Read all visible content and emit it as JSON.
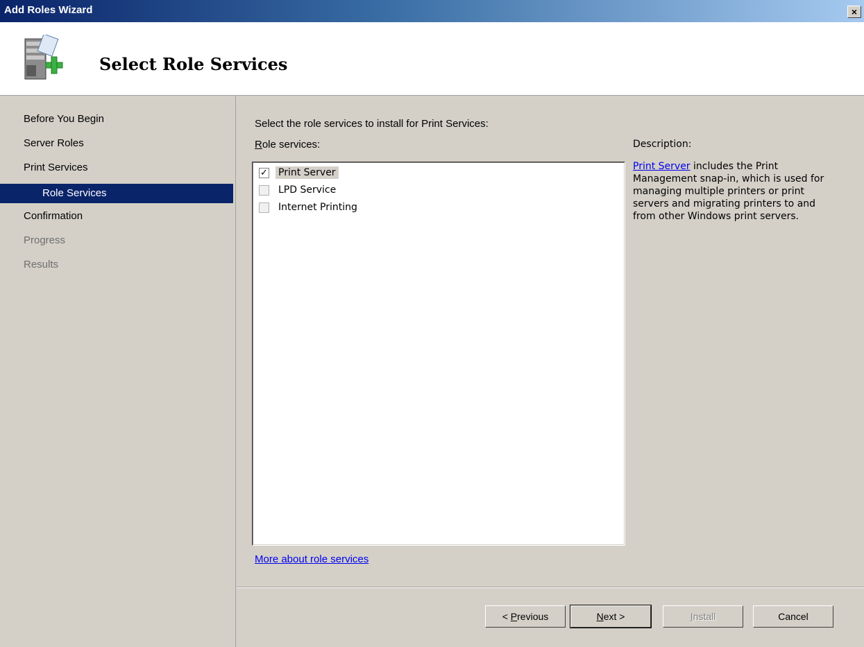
{
  "window": {
    "title": "Add Roles Wizard",
    "close_label": "×"
  },
  "header": {
    "page_title": "Select Role Services"
  },
  "nav": {
    "items": [
      {
        "label": "Before You Begin",
        "state": "normal"
      },
      {
        "label": "Server Roles",
        "state": "normal"
      },
      {
        "label": "Print Services",
        "state": "normal"
      },
      {
        "label": "Role Services",
        "state": "selected"
      },
      {
        "label": "Confirmation",
        "state": "normal"
      },
      {
        "label": "Progress",
        "state": "disabled"
      },
      {
        "label": "Results",
        "state": "disabled"
      }
    ]
  },
  "main": {
    "instruction": "Select the role services to install for Print Services:",
    "list_label_accel": "R",
    "list_label_rest": "ole services:",
    "role_services": [
      {
        "label": "Print Server",
        "checked": true,
        "check_glyph": "✓"
      },
      {
        "label": "LPD Service",
        "checked": false
      },
      {
        "label": "Internet Printing",
        "checked": false
      }
    ],
    "more_link": "More about role services"
  },
  "description": {
    "title": "Description:",
    "link_text": "Print Server",
    "body": " includes the Print Management snap-in, which is used for managing multiple printers or print servers and migrating printers to and from other Windows print servers."
  },
  "buttons": {
    "previous_pre": "< ",
    "previous_accel": "P",
    "previous_rest": "revious",
    "next_accel": "N",
    "next_rest": "ext >",
    "install_accel": "I",
    "install_rest": "nstall",
    "cancel": "Cancel"
  },
  "icons": {
    "header_icon": "server-add-icon"
  },
  "colors": {
    "selection": "#0a246a",
    "link": "#0000ee",
    "dialog_bg": "#d4d0c8"
  }
}
